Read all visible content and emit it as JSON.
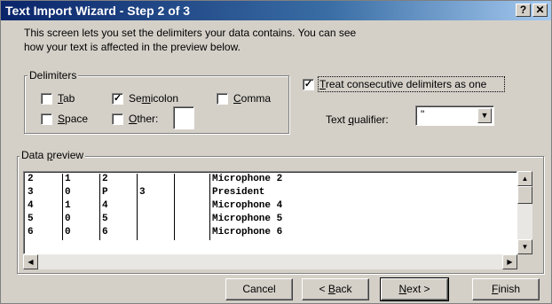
{
  "window": {
    "title": "Text Import Wizard - Step 2 of 3",
    "help_button": "?",
    "close_button": "✕"
  },
  "intro": {
    "line1": "This screen lets you set the delimiters your data contains.  You can see",
    "line2": "how your text is affected in the preview below."
  },
  "delimiters": {
    "legend": "Delimiters",
    "tab": {
      "pre": "",
      "key": "T",
      "post": "ab",
      "checked": false
    },
    "semicolon": {
      "pre": "Se",
      "key": "m",
      "post": "icolon",
      "checked": true
    },
    "comma": {
      "pre": "",
      "key": "C",
      "post": "omma",
      "checked": false
    },
    "space": {
      "pre": "",
      "key": "S",
      "post": "pace",
      "checked": false
    },
    "other": {
      "pre": "",
      "key": "O",
      "post": "ther:",
      "checked": false,
      "value": ""
    }
  },
  "consecutive": {
    "pre": "",
    "key": "T",
    "post": "reat consecutive delimiters as one",
    "checked": true
  },
  "qualifier": {
    "pre": "Text ",
    "key": "q",
    "post": "ualifier:",
    "value": "\""
  },
  "preview": {
    "legend_pre": "Data ",
    "legend_key": "p",
    "legend_post": "review",
    "rows": [
      [
        "2",
        "1",
        "2",
        "",
        "",
        "Microphone 2"
      ],
      [
        "3",
        "0",
        "P",
        "3",
        "",
        "President"
      ],
      [
        "4",
        "1",
        "4",
        "",
        "",
        "Microphone 4"
      ],
      [
        "5",
        "0",
        "5",
        "",
        "",
        "Microphone 5"
      ],
      [
        "6",
        "0",
        "6",
        "",
        "",
        "Microphone 6"
      ]
    ]
  },
  "buttons": {
    "cancel": "Cancel",
    "back_pre": "< ",
    "back_key": "B",
    "back_post": "ack",
    "next_pre": "",
    "next_key": "N",
    "next_post": "ext >",
    "finish_pre": "",
    "finish_key": "F",
    "finish_post": "inish"
  },
  "icons": {
    "check": "✓",
    "dropdown": "chevron-down-icon",
    "scroll_up": "▲",
    "scroll_down": "▼",
    "scroll_left": "◀",
    "scroll_right": "▶",
    "dropdown_glyph": "▼"
  }
}
